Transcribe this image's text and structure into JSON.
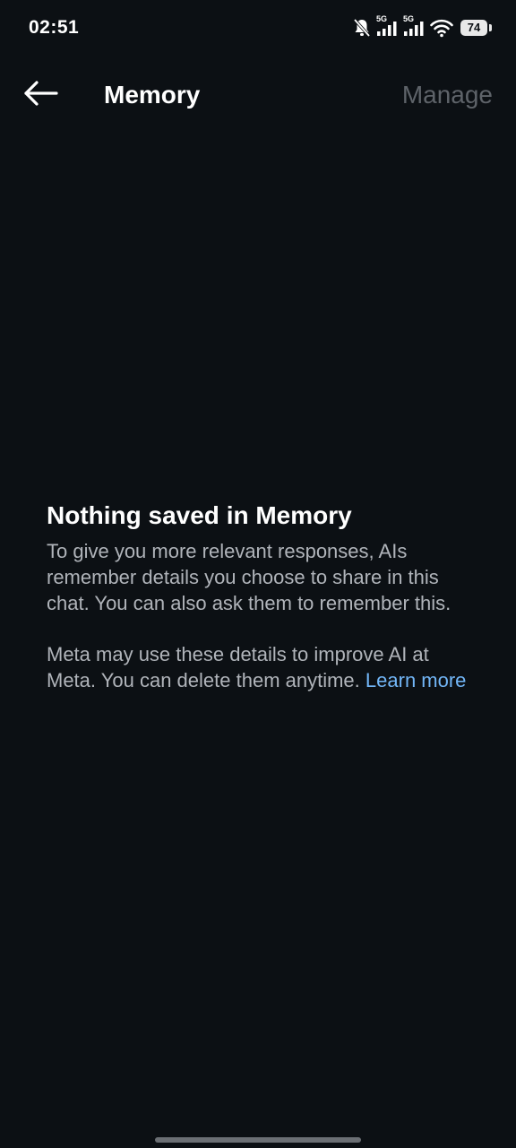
{
  "status_bar": {
    "time": "02:51",
    "network_1": "5G",
    "network_2": "5G",
    "battery_level": "74",
    "icons": [
      "mute-bell-icon",
      "signal-5g-icon",
      "signal-5g-icon",
      "wifi-icon",
      "battery-icon"
    ]
  },
  "app_bar": {
    "title": "Memory",
    "manage_label": "Manage",
    "back_icon": "arrow-left-icon"
  },
  "empty_state": {
    "title": "Nothing saved in Memory",
    "paragraph_1": "To give you more relevant responses, AIs remember details you choose to share in this chat. You can also ask them to remember this.",
    "paragraph_2": "Meta may use these details to improve AI at Meta. You can delete them anytime.",
    "learn_more_label": "Learn more"
  },
  "colors": {
    "background": "#0c1014",
    "primary_text": "#ffffff",
    "secondary_text": "#b0b4ba",
    "disabled_text": "#5e6369",
    "link": "#72b6f7"
  }
}
